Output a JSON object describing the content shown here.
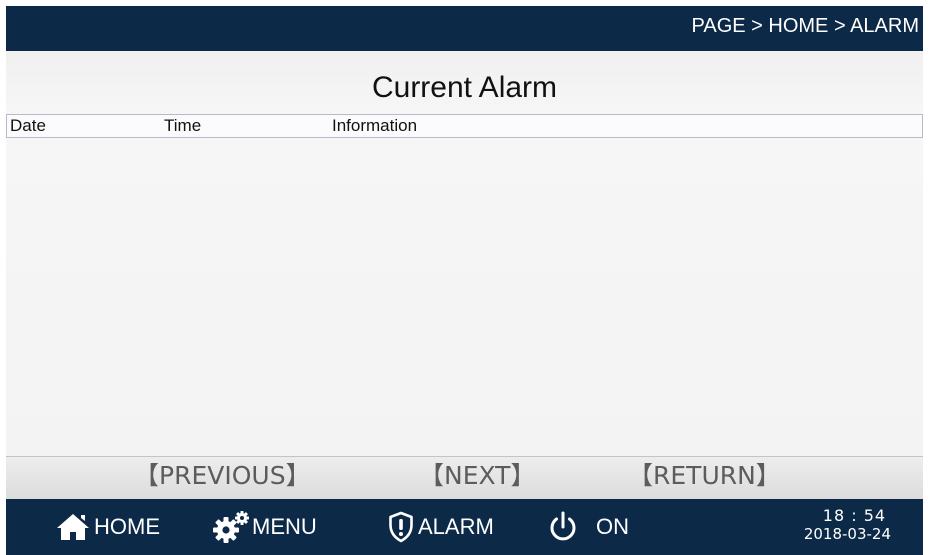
{
  "topbar": {
    "breadcrumb": "PAGE > HOME > ALARM"
  },
  "page": {
    "title": "Current Alarm"
  },
  "table": {
    "columns": [
      "Date",
      "Time",
      "Information"
    ],
    "rows": []
  },
  "pager": {
    "previous": "【PREVIOUS】",
    "next": "【NEXT】",
    "return": "【RETURN】"
  },
  "bottombar": {
    "home": "HOME",
    "menu": "MENU",
    "alarm": "ALARM",
    "power": "ON",
    "time": "18 : 54",
    "date": "2018-03-24"
  },
  "colors": {
    "bar": "#0c2a48",
    "panel": "#f2f2f2",
    "pager_text": "#5c5c5c"
  }
}
